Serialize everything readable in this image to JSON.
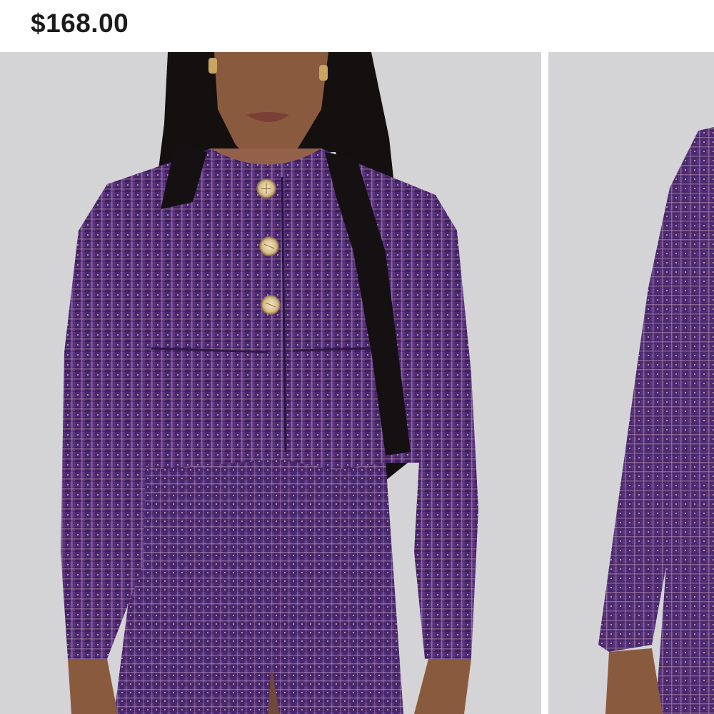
{
  "product": {
    "price": "$168.00"
  },
  "gallery": {
    "images": [
      {
        "alt": "model-front-view",
        "icon": "product-photo"
      },
      {
        "alt": "model-side-view",
        "icon": "product-photo"
      }
    ]
  },
  "colors": {
    "tweed_purple": "#4b2a6e",
    "background_gray": "#d4d4d6",
    "button_gold": "#d8c49a"
  }
}
